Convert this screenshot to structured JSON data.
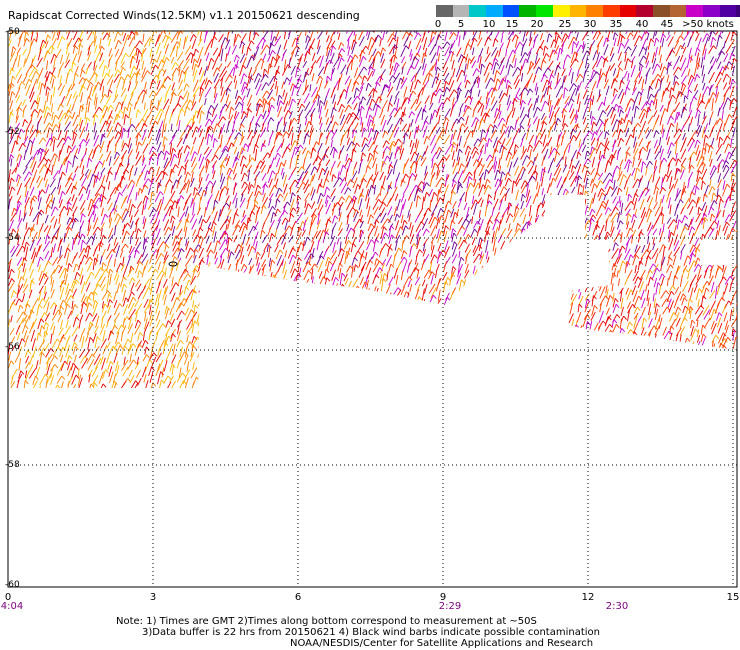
{
  "title": "Rapidscat Corrected Winds(12.5KM) v1.1 20150621 descending",
  "legend": {
    "labels": [
      "0",
      "5",
      "10",
      "15",
      "20",
      "25",
      "30",
      "35",
      "40",
      "45",
      ">50 knots"
    ],
    "colors": [
      "#666666",
      "#b5b5b5",
      "#00c8c8",
      "#00aaff",
      "#0050ff",
      "#00b400",
      "#00e600",
      "#fff000",
      "#ffb400",
      "#ff8000",
      "#ff3c00",
      "#e60000",
      "#b4002d",
      "#8c5028",
      "#b46432",
      "#c800c8",
      "#8c00c8",
      "#5000a0",
      "#3c0078",
      "#280050"
    ]
  },
  "map": {
    "x_axis": {
      "labels": [
        "0",
        "3",
        "6",
        "9",
        "12",
        "15"
      ]
    },
    "y_axis": {
      "labels": [
        "-50",
        "-52",
        "-54",
        "-56",
        "-58",
        "-60"
      ]
    },
    "times": [
      "4:04",
      "2:29",
      "2:30"
    ]
  },
  "notes": [
    "Note: 1) Times are GMT 2)Times along bottom correspond to measurement at ~50S",
    "3)Data buffer is 22 hrs from 20150621 4) Black wind barbs indicate possible contamination",
    "NOAA/NESDIS/Center for Satellite Applications and Research"
  ]
}
